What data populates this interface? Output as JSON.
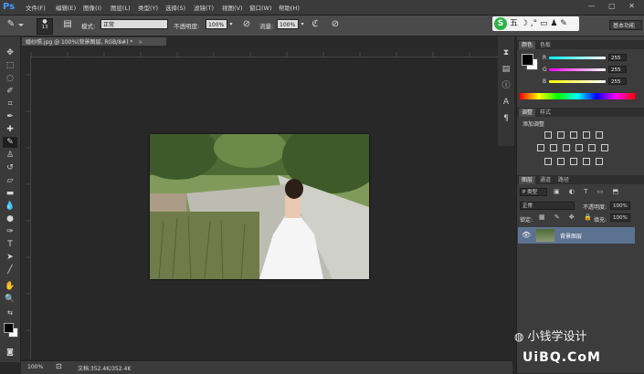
{
  "app": {
    "logo": "Ps",
    "menus": [
      "文件(F)",
      "编辑(E)",
      "图像(I)",
      "图层(L)",
      "类型(Y)",
      "选择(S)",
      "滤镜(T)",
      "视图(V)",
      "窗口(W)",
      "帮助(H)"
    ],
    "window_controls": "— ▢ ✕"
  },
  "options_bar": {
    "brush_size": "13",
    "mode_label": "模式:",
    "mode_value": "正常",
    "opacity_label": "不透明度:",
    "opacity_value": "100%",
    "flow_label": "流量:",
    "flow_value": "100%",
    "workspace_value": "基本功能"
  },
  "ime": {
    "logo": "S",
    "glyphs": "五 ☽ ,° ▭ ♟ ✎"
  },
  "document": {
    "tab_label": "婚纱照.jpg @ 100%(背景图层, RGB/8#) *",
    "zoom": "100%",
    "doc_info": "文档:352.4K/352.4K"
  },
  "color_panel": {
    "tabs": [
      "颜色",
      "色板"
    ],
    "r_label": "R",
    "g_label": "G",
    "b_label": "B",
    "r_value": "255",
    "g_value": "255",
    "b_value": "255"
  },
  "adjust_panel": {
    "tabs": [
      "调整",
      "样式"
    ],
    "title": "添加调整"
  },
  "layers_panel": {
    "tabs": [
      "图层",
      "通道",
      "路径"
    ],
    "kind_filter": "P 类型",
    "blend_mode": "正常",
    "opacity_label": "不透明度:",
    "opacity_value": "100%",
    "lock_label": "锁定:",
    "fill_label": "填充:",
    "fill_value": "100%",
    "layer_name": "背景图层"
  },
  "watermarks": {
    "wechat": "小钱学设计",
    "site": "UiBQ.CoM"
  },
  "colors": {
    "accent": "#5d7290",
    "menubar": "#3b3b3b",
    "canvas_bg": "#282828"
  }
}
